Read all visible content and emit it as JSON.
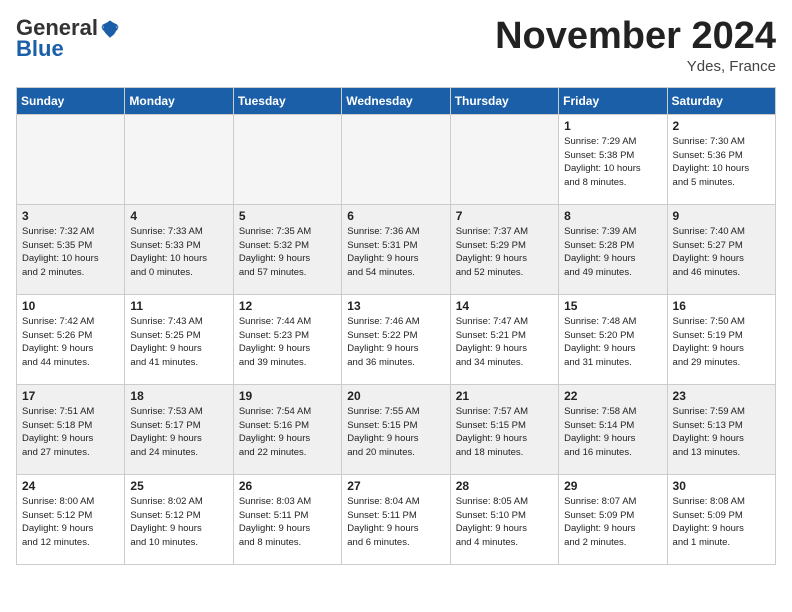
{
  "logo": {
    "line1": "General",
    "line2": "Blue"
  },
  "title": "November 2024",
  "location": "Ydes, France",
  "weekdays": [
    "Sunday",
    "Monday",
    "Tuesday",
    "Wednesday",
    "Thursday",
    "Friday",
    "Saturday"
  ],
  "weeks": [
    [
      {
        "num": "",
        "info": ""
      },
      {
        "num": "",
        "info": ""
      },
      {
        "num": "",
        "info": ""
      },
      {
        "num": "",
        "info": ""
      },
      {
        "num": "",
        "info": ""
      },
      {
        "num": "1",
        "info": "Sunrise: 7:29 AM\nSunset: 5:38 PM\nDaylight: 10 hours\nand 8 minutes."
      },
      {
        "num": "2",
        "info": "Sunrise: 7:30 AM\nSunset: 5:36 PM\nDaylight: 10 hours\nand 5 minutes."
      }
    ],
    [
      {
        "num": "3",
        "info": "Sunrise: 7:32 AM\nSunset: 5:35 PM\nDaylight: 10 hours\nand 2 minutes."
      },
      {
        "num": "4",
        "info": "Sunrise: 7:33 AM\nSunset: 5:33 PM\nDaylight: 10 hours\nand 0 minutes."
      },
      {
        "num": "5",
        "info": "Sunrise: 7:35 AM\nSunset: 5:32 PM\nDaylight: 9 hours\nand 57 minutes."
      },
      {
        "num": "6",
        "info": "Sunrise: 7:36 AM\nSunset: 5:31 PM\nDaylight: 9 hours\nand 54 minutes."
      },
      {
        "num": "7",
        "info": "Sunrise: 7:37 AM\nSunset: 5:29 PM\nDaylight: 9 hours\nand 52 minutes."
      },
      {
        "num": "8",
        "info": "Sunrise: 7:39 AM\nSunset: 5:28 PM\nDaylight: 9 hours\nand 49 minutes."
      },
      {
        "num": "9",
        "info": "Sunrise: 7:40 AM\nSunset: 5:27 PM\nDaylight: 9 hours\nand 46 minutes."
      }
    ],
    [
      {
        "num": "10",
        "info": "Sunrise: 7:42 AM\nSunset: 5:26 PM\nDaylight: 9 hours\nand 44 minutes."
      },
      {
        "num": "11",
        "info": "Sunrise: 7:43 AM\nSunset: 5:25 PM\nDaylight: 9 hours\nand 41 minutes."
      },
      {
        "num": "12",
        "info": "Sunrise: 7:44 AM\nSunset: 5:23 PM\nDaylight: 9 hours\nand 39 minutes."
      },
      {
        "num": "13",
        "info": "Sunrise: 7:46 AM\nSunset: 5:22 PM\nDaylight: 9 hours\nand 36 minutes."
      },
      {
        "num": "14",
        "info": "Sunrise: 7:47 AM\nSunset: 5:21 PM\nDaylight: 9 hours\nand 34 minutes."
      },
      {
        "num": "15",
        "info": "Sunrise: 7:48 AM\nSunset: 5:20 PM\nDaylight: 9 hours\nand 31 minutes."
      },
      {
        "num": "16",
        "info": "Sunrise: 7:50 AM\nSunset: 5:19 PM\nDaylight: 9 hours\nand 29 minutes."
      }
    ],
    [
      {
        "num": "17",
        "info": "Sunrise: 7:51 AM\nSunset: 5:18 PM\nDaylight: 9 hours\nand 27 minutes."
      },
      {
        "num": "18",
        "info": "Sunrise: 7:53 AM\nSunset: 5:17 PM\nDaylight: 9 hours\nand 24 minutes."
      },
      {
        "num": "19",
        "info": "Sunrise: 7:54 AM\nSunset: 5:16 PM\nDaylight: 9 hours\nand 22 minutes."
      },
      {
        "num": "20",
        "info": "Sunrise: 7:55 AM\nSunset: 5:15 PM\nDaylight: 9 hours\nand 20 minutes."
      },
      {
        "num": "21",
        "info": "Sunrise: 7:57 AM\nSunset: 5:15 PM\nDaylight: 9 hours\nand 18 minutes."
      },
      {
        "num": "22",
        "info": "Sunrise: 7:58 AM\nSunset: 5:14 PM\nDaylight: 9 hours\nand 16 minutes."
      },
      {
        "num": "23",
        "info": "Sunrise: 7:59 AM\nSunset: 5:13 PM\nDaylight: 9 hours\nand 13 minutes."
      }
    ],
    [
      {
        "num": "24",
        "info": "Sunrise: 8:00 AM\nSunset: 5:12 PM\nDaylight: 9 hours\nand 12 minutes."
      },
      {
        "num": "25",
        "info": "Sunrise: 8:02 AM\nSunset: 5:12 PM\nDaylight: 9 hours\nand 10 minutes."
      },
      {
        "num": "26",
        "info": "Sunrise: 8:03 AM\nSunset: 5:11 PM\nDaylight: 9 hours\nand 8 minutes."
      },
      {
        "num": "27",
        "info": "Sunrise: 8:04 AM\nSunset: 5:11 PM\nDaylight: 9 hours\nand 6 minutes."
      },
      {
        "num": "28",
        "info": "Sunrise: 8:05 AM\nSunset: 5:10 PM\nDaylight: 9 hours\nand 4 minutes."
      },
      {
        "num": "29",
        "info": "Sunrise: 8:07 AM\nSunset: 5:09 PM\nDaylight: 9 hours\nand 2 minutes."
      },
      {
        "num": "30",
        "info": "Sunrise: 8:08 AM\nSunset: 5:09 PM\nDaylight: 9 hours\nand 1 minute."
      }
    ]
  ]
}
